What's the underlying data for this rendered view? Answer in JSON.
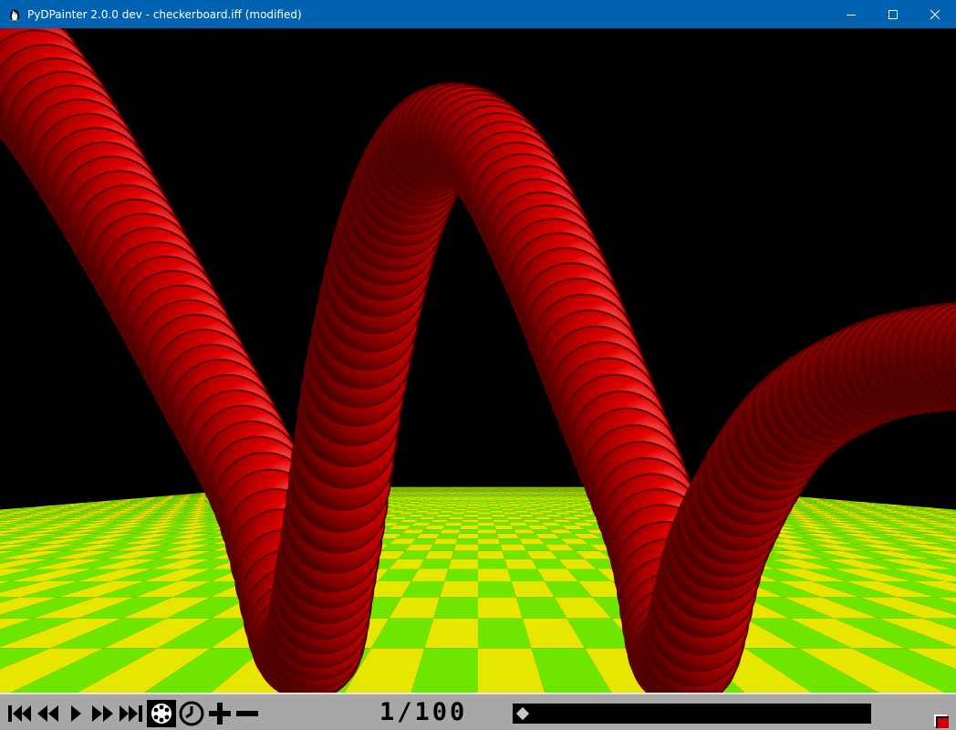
{
  "window": {
    "title": "PyDPainter 2.0.0 dev - checkerboard.iff (modified)",
    "controls": [
      "minimize",
      "maximize",
      "close"
    ]
  },
  "colors": {
    "titlebar": "#0063b1",
    "background": "#000000",
    "checker_yellow": "#e6e600",
    "checker_green": "#6ee600",
    "tube_red": "#cc0000",
    "tube_dark": "#5a0000",
    "tube_highlight": "#ff8a8a",
    "anim_bar": "#a7a7a7"
  },
  "animation_bar": {
    "frame_counter": "1/100",
    "current_frame": 1,
    "total_frames": 100,
    "position_fraction": 0.0,
    "tools": [
      {
        "name": "first-frame",
        "icon": "first-frame-icon"
      },
      {
        "name": "previous-frame",
        "icon": "previous-frame-icon"
      },
      {
        "name": "play",
        "icon": "play-icon"
      },
      {
        "name": "next-frame",
        "icon": "next-frame-icon"
      },
      {
        "name": "last-frame",
        "icon": "last-frame-icon"
      },
      {
        "name": "frame-palette",
        "icon": "palette-icon"
      },
      {
        "name": "frame-timing",
        "icon": "clock-icon"
      },
      {
        "name": "add-frame",
        "icon": "plus-icon"
      },
      {
        "name": "delete-frame",
        "icon": "minus-icon"
      }
    ]
  }
}
